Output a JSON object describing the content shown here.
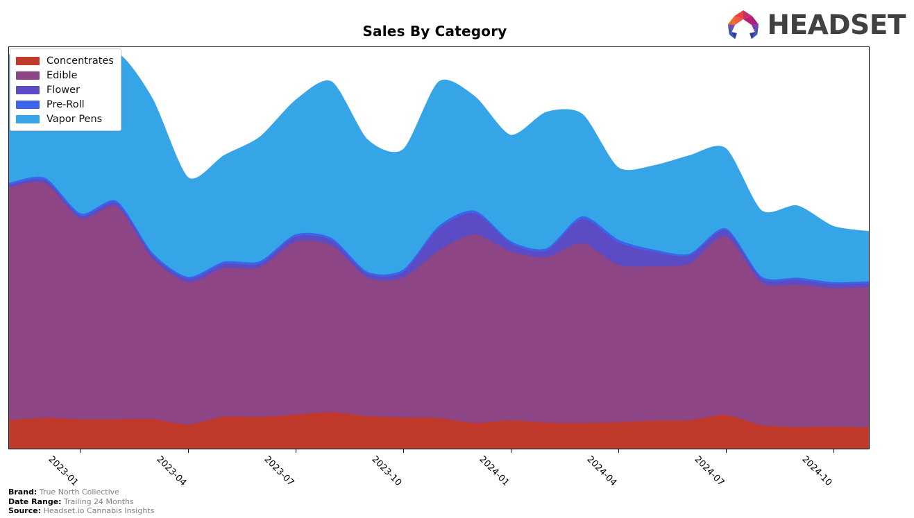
{
  "header": {
    "title": "Sales By Category",
    "logo_text": "HEADSET",
    "logo_mark_name": "headset-hexagon-logo"
  },
  "legend": {
    "position": "upper-left",
    "items": [
      {
        "label": "Concentrates",
        "color": "#C0392B"
      },
      {
        "label": "Edible",
        "color": "#8E4585"
      },
      {
        "label": "Flower",
        "color": "#5B4BC4"
      },
      {
        "label": "Pre-Roll",
        "color": "#3C64E8"
      },
      {
        "label": "Vapor Pens",
        "color": "#36A5E8"
      }
    ]
  },
  "footer": {
    "rows": [
      {
        "key": "Brand:",
        "value": "True North Collective"
      },
      {
        "key": "Date Range:",
        "value": "Trailing 24 Months"
      },
      {
        "key": "Source:",
        "value": "Headset.io Cannabis Insights"
      }
    ]
  },
  "chart_data": {
    "type": "area",
    "stacked": true,
    "title": "Sales By Category",
    "xlabel": "",
    "ylabel": "",
    "grid": false,
    "legend_position": "upper-left",
    "axis_ticks_visible": {
      "x": true,
      "y": false
    },
    "x": [
      "2022-11",
      "2022-12",
      "2023-01",
      "2023-02",
      "2023-03",
      "2023-04",
      "2023-05",
      "2023-06",
      "2023-07",
      "2023-08",
      "2023-09",
      "2023-10",
      "2023-11",
      "2023-12",
      "2024-01",
      "2024-02",
      "2024-03",
      "2024-04",
      "2024-05",
      "2024-06",
      "2024-07",
      "2024-08",
      "2024-09",
      "2024-10",
      "2024-11"
    ],
    "tick_labels": [
      "2023-01",
      "2023-04",
      "2023-07",
      "2023-10",
      "2024-01",
      "2024-04",
      "2024-07",
      "2024-10"
    ],
    "tick_x_index": [
      2,
      5,
      8,
      11,
      14,
      17,
      20,
      23
    ],
    "ylim": [
      0,
      100
    ],
    "series": [
      {
        "name": "Concentrates",
        "color": "#C0392B",
        "values": [
          7.0,
          7.6,
          7.2,
          7.2,
          7.3,
          5.9,
          7.9,
          7.8,
          8.4,
          9.0,
          8.0,
          7.7,
          7.5,
          6.3,
          7.0,
          6.4,
          6.3,
          6.5,
          6.9,
          7.0,
          8.3,
          5.8,
          5.3,
          5.4,
          5.2
        ]
      },
      {
        "name": "Edible",
        "color": "#8E4585",
        "values": [
          58.0,
          58.5,
          50.0,
          53.0,
          40.0,
          35.5,
          37.0,
          37.3,
          43.0,
          41.5,
          34.5,
          34.8,
          41.8,
          47.0,
          42.0,
          41.2,
          44.8,
          39.2,
          38.5,
          39.0,
          44.5,
          35.5,
          35.5,
          34.5,
          35.0
        ]
      },
      {
        "name": "Flower",
        "color": "#5B4BC4",
        "values": [
          0.6,
          0.7,
          0.7,
          0.8,
          0.8,
          0.8,
          1.0,
          0.9,
          1.3,
          1.3,
          1.0,
          1.4,
          5.4,
          5.2,
          2.0,
          1.6,
          6.0,
          5.6,
          3.5,
          2.0,
          1.5,
          1.0,
          1.2,
          1.0,
          0.9
        ]
      },
      {
        "name": "Pre-Roll",
        "color": "#3C64E8",
        "values": [
          0.5,
          0.6,
          0.6,
          0.6,
          0.6,
          0.5,
          0.6,
          0.6,
          0.6,
          0.6,
          0.5,
          0.6,
          0.7,
          0.7,
          0.6,
          0.6,
          0.7,
          0.7,
          0.6,
          0.5,
          0.5,
          0.5,
          0.5,
          0.5,
          0.5
        ]
      },
      {
        "name": "Vapor Pens",
        "color": "#36A5E8",
        "values": [
          32.0,
          31.0,
          35.0,
          37.0,
          38.5,
          24.8,
          26.5,
          31.0,
          33.5,
          39.0,
          33.0,
          30.0,
          36.0,
          28.5,
          26.5,
          34.0,
          25.5,
          18.0,
          21.0,
          24.5,
          20.0,
          16.5,
          18.0,
          14.0,
          12.5
        ]
      }
    ]
  }
}
